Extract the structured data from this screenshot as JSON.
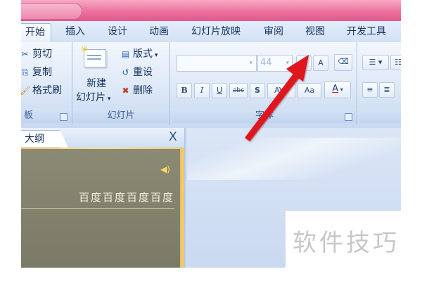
{
  "tabs": [
    "开始",
    "插入",
    "设计",
    "动画",
    "幻灯片放映",
    "审阅",
    "视图",
    "开发工具"
  ],
  "clipboard": {
    "cut": "剪切",
    "copy": "复制",
    "format_painter": "格式刷",
    "group_label": "板"
  },
  "slides": {
    "new_slide_line1": "新建",
    "new_slide_line2": "幻灯片",
    "layout": "版式",
    "reset": "重设",
    "delete": "删除",
    "group_label": "幻灯片"
  },
  "font": {
    "font_size": "44",
    "grow": "A",
    "shrink": "A",
    "bold": "B",
    "italic": "I",
    "underline": "U",
    "strikethrough": "abc",
    "shadow": "S",
    "change_case": "Aa",
    "color": "A",
    "group_label": "字体"
  },
  "panel": {
    "outline_tab": "大纲",
    "close": "X",
    "slide_text": "百度百度百度百度"
  },
  "watermark": "软件技巧",
  "colors": {
    "titlebar": "#e85c8f",
    "ribbon": "#dde8f7",
    "thumb_bg": "#7f7e6a",
    "arrow": "#e0121b"
  }
}
